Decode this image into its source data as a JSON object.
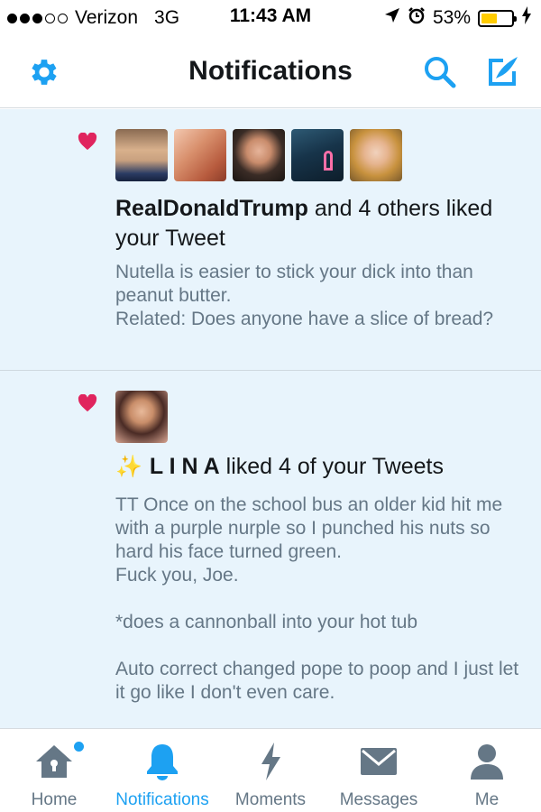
{
  "status_bar": {
    "carrier": "Verizon",
    "network": "3G",
    "time": "11:43 AM",
    "battery": "53%",
    "battery_level": 0.53,
    "signal_bars": 3,
    "icons": [
      "location-icon",
      "alarm-icon",
      "battery-icon",
      "charging-icon"
    ]
  },
  "header": {
    "title": "Notifications",
    "icons": [
      "gear-icon",
      "search-icon",
      "compose-icon"
    ],
    "accent_color": "#1da1f2"
  },
  "notifications": [
    {
      "type": "like",
      "icon": "heart-icon",
      "avatars": [
        "RealDonaldTrump",
        "user-2",
        "user-3",
        "user-4",
        "user-5"
      ],
      "actor": "RealDonaldTrump",
      "action": " and 4 others liked your Tweet",
      "text": "Nutella is easier to stick your dick into than peanut butter.\nRelated: Does anyone have a slice of bread?"
    },
    {
      "type": "like",
      "icon": "heart-icon",
      "sparkle": "✨",
      "actor": "L I N A",
      "action": " liked 4 of your Tweets",
      "text": "TT Once on the school bus an older kid hit me with a purple nurple so I punched his nuts so hard his face turned green.\nFuck you, Joe.\n\n*does a cannonball into your hot tub\n\nAuto correct changed pope to poop and I just let it go like I don't even care."
    }
  ],
  "tabbar": {
    "tabs": [
      {
        "label": "Home",
        "icon": "home-icon",
        "has_dot": true
      },
      {
        "label": "Notifications",
        "icon": "bell-icon",
        "active": true
      },
      {
        "label": "Moments",
        "icon": "lightning-icon"
      },
      {
        "label": "Messages",
        "icon": "envelope-icon"
      },
      {
        "label": "Me",
        "icon": "person-icon"
      }
    ],
    "active_color": "#1da1f2",
    "inactive_color": "#657786"
  }
}
